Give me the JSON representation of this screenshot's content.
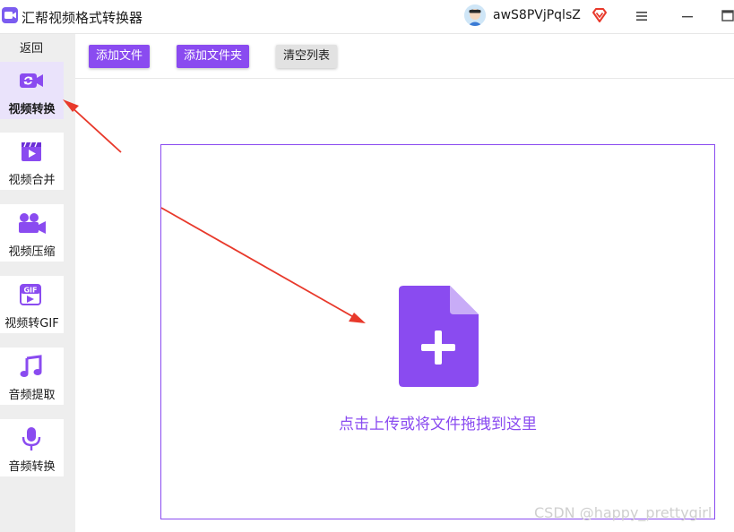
{
  "app": {
    "title": "汇帮视频格式转换器"
  },
  "user": {
    "name": "awS8PVjPqlsZ"
  },
  "sidebar": {
    "back_label": "返回",
    "items": [
      {
        "label": "视频转换",
        "icon": "video-convert-icon",
        "active": true
      },
      {
        "label": "视频合并",
        "icon": "video-merge-icon"
      },
      {
        "label": "视频压缩",
        "icon": "video-compress-icon"
      },
      {
        "label": "视频转GIF",
        "icon": "gif-icon"
      },
      {
        "label": "音频提取",
        "icon": "music-note-icon"
      },
      {
        "label": "音频转换",
        "icon": "microphone-icon"
      }
    ]
  },
  "toolbar": {
    "add_file_label": "添加文件",
    "add_folder_label": "添加文件夹",
    "clear_list_label": "清空列表"
  },
  "dropzone": {
    "hint": "点击上传或将文件拖拽到这里"
  },
  "watermark": "CSDN @happy_prettygirl",
  "colors": {
    "accent": "#8a4bf0",
    "sidebar_bg": "#eeeeee",
    "active_item_bg": "#eae3fb",
    "annotation_arrow": "#e8392b"
  }
}
